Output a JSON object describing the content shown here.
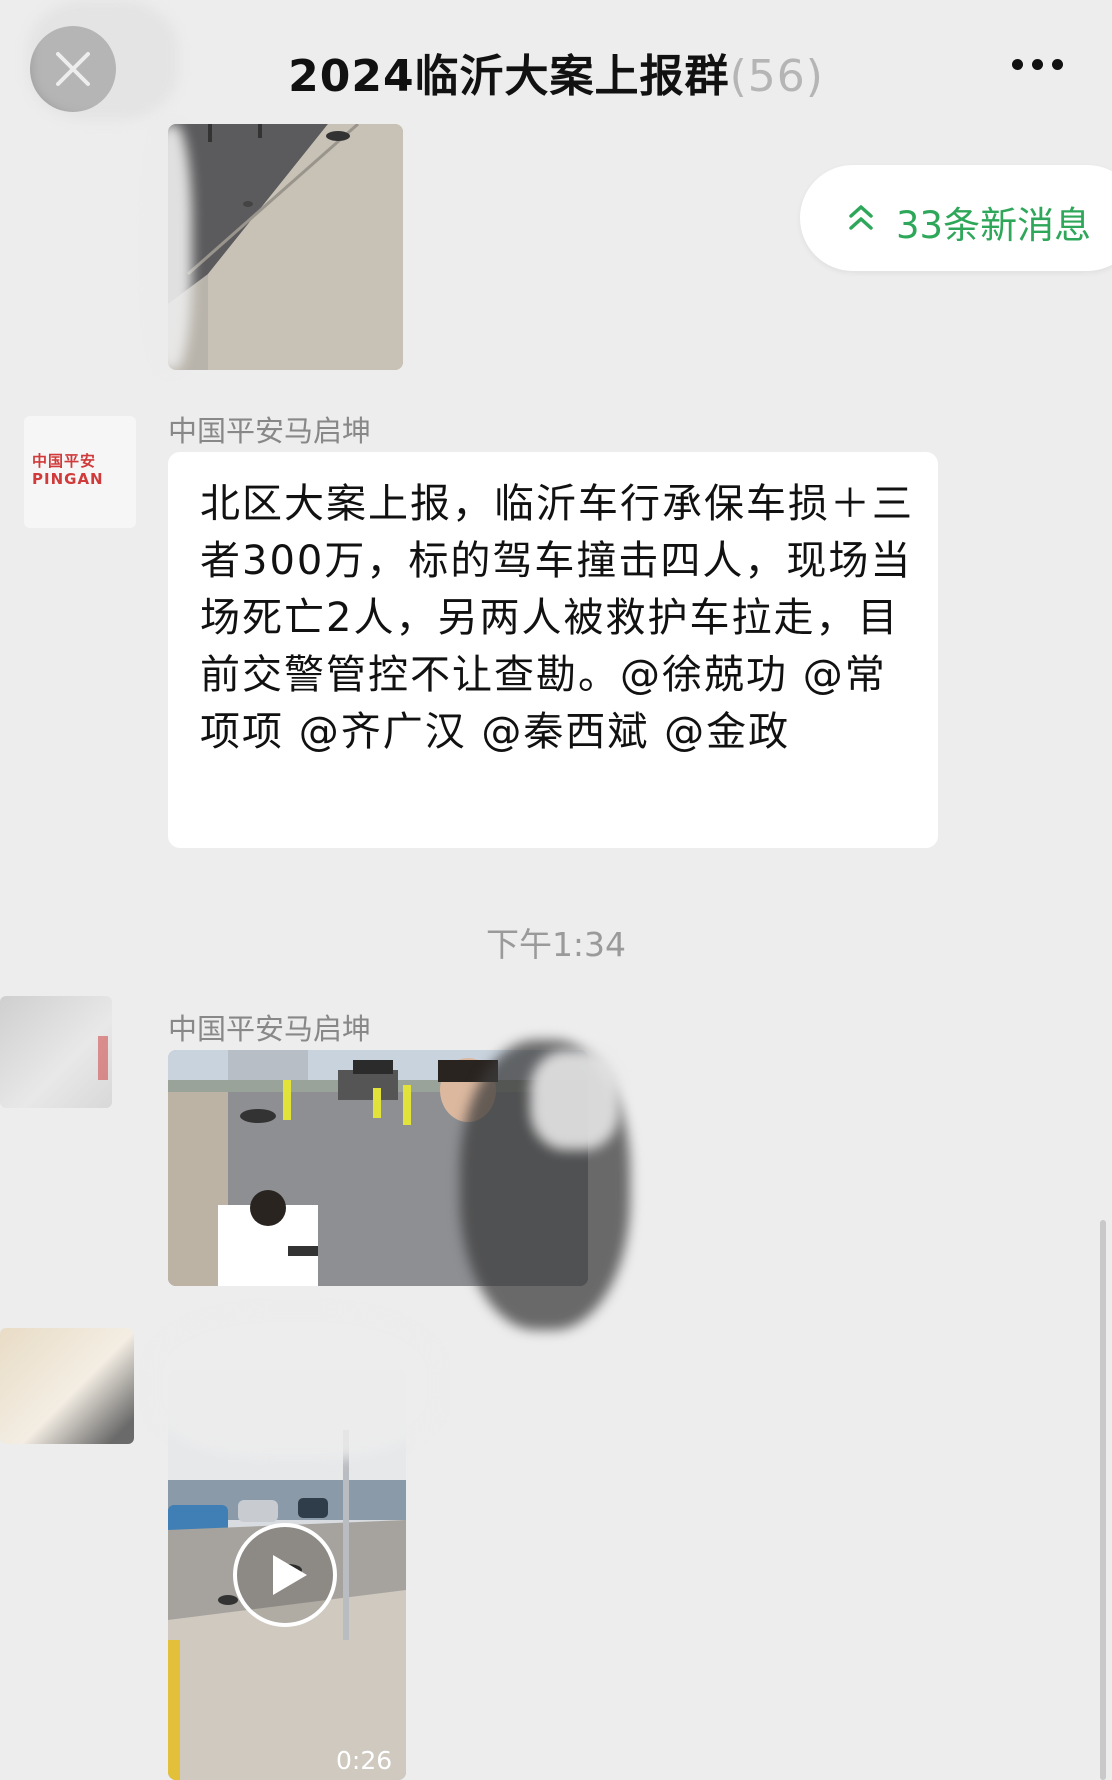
{
  "header": {
    "title": "2024临沂大案上报群",
    "member_count": "(56)",
    "close_icon": "close-icon",
    "more_icon": "more-icon"
  },
  "new_messages": {
    "label": "33条新消息",
    "icon": "double-chevron-up-icon"
  },
  "messages": [
    {
      "type": "image",
      "icon": "road-photo"
    },
    {
      "type": "text",
      "sender": "中国平安马启坤",
      "avatar_text": "中国平安 PINGAN",
      "text": "北区大案上报，临沂车行承保车损＋三者300万，标的驾车撞击四人，现场当场死亡2人，另两人被救护车拉走，目前交警管控不让查勘。@徐兢功 @常项项 @齐广汉 @秦西斌 @金政"
    },
    {
      "type": "timestamp",
      "text": "下午1:34"
    },
    {
      "type": "image",
      "sender": "中国平安马启坤",
      "icon": "accident-scene-photo"
    },
    {
      "type": "video",
      "sender": "",
      "duration": "0:26",
      "icon": "play-icon"
    }
  ],
  "colors": {
    "background": "#ededed",
    "bubble": "#ffffff",
    "accent_green": "#2fa75a",
    "brand_red": "#d03a3a"
  }
}
